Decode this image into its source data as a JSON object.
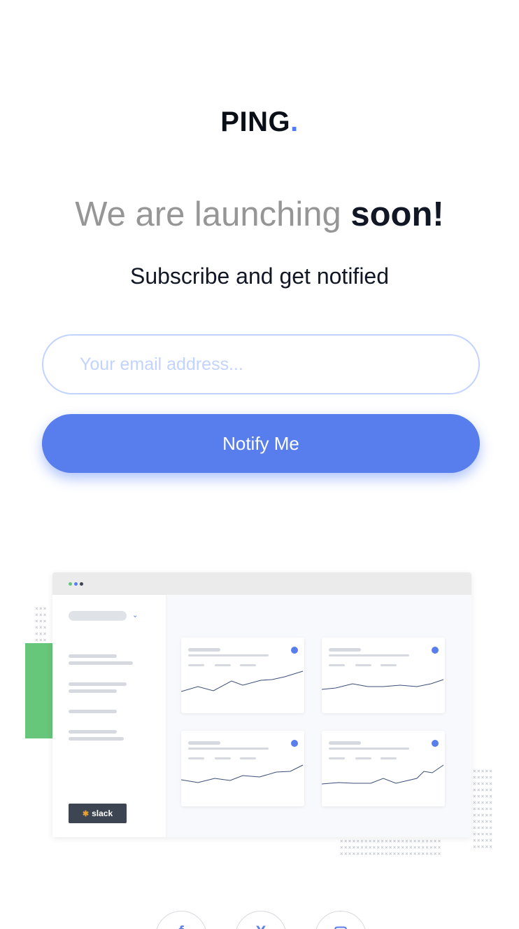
{
  "brand": {
    "name": "PING",
    "dot": ".",
    "accent": "#4f7df3"
  },
  "hero": {
    "headline_light": "We are launching",
    "headline_bold": "soon!",
    "subtitle": "Subscribe and get notified"
  },
  "form": {
    "email_placeholder": "Your email address...",
    "email_value": "",
    "submit_label": "Notify Me"
  },
  "illustration": {
    "slack_label": "slack",
    "slack_icon": "slack-logo-icon"
  },
  "social": {
    "icons": [
      "facebook-icon",
      "twitter-x-icon",
      "instagram-icon"
    ]
  }
}
